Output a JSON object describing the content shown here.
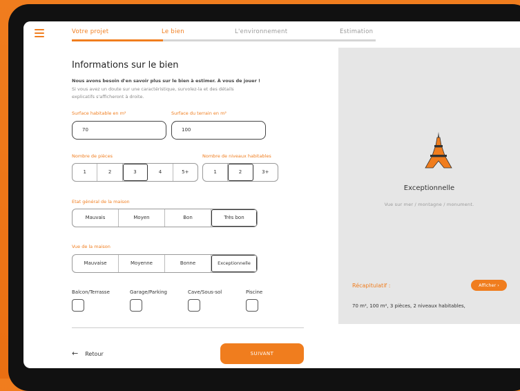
{
  "nav": {
    "steps": [
      "Votre projet",
      "Le bien",
      "L'environnement",
      "Estimation"
    ],
    "progress": 0.3
  },
  "form": {
    "title": "Informations sur le bien",
    "intro_bold": "Nous avons besoin d'en savoir plus sur le bien à estimer. À vous de jouer !",
    "intro_line2": "Si vous avez un doute sur une caractéristique, survolez-la et des détails",
    "intro_line3": "explicatifs s'afficheront à droite.",
    "surface_habitable": {
      "label": "Surface habitable en m²",
      "value": "70"
    },
    "surface_terrain": {
      "label": "Surface du terrain en m²",
      "value": "100"
    },
    "pieces": {
      "label": "Nombre de pièces",
      "options": [
        "1",
        "2",
        "3",
        "4",
        "5+"
      ],
      "selected": "3"
    },
    "niveaux": {
      "label": "Nombre de niveaux habitables",
      "options": [
        "1",
        "2",
        "3+"
      ],
      "selected": "2"
    },
    "etat": {
      "label": "Etat général de la maison",
      "options": [
        "Mauvais",
        "Moyen",
        "Bon",
        "Très bon"
      ],
      "selected": "Très bon"
    },
    "vue": {
      "label": "Vue de la maison",
      "options": [
        "Mauvaise",
        "Moyenne",
        "Bonne",
        "Exceptionnelle"
      ],
      "selected": "Exceptionnelle"
    },
    "checkboxes": [
      "Balcon/Terrasse",
      "Garage/Parking",
      "Cave/Sous-sol",
      "Piscine"
    ],
    "back_label": "Retour",
    "next_label": "SUIVANT"
  },
  "panel": {
    "icon": "eiffel-tower-icon",
    "title": "Exceptionnelle",
    "description": "Vue sur mer / montagne / monument.",
    "recap_label": "Récapitulatif :",
    "recap_button": "Afficher ›",
    "recap_text": "70 m², 100 m², 3 pièces, 2 niveaux habitables,"
  },
  "colors": {
    "accent": "#f07d1e",
    "panel_bg": "#e6e6e6"
  }
}
